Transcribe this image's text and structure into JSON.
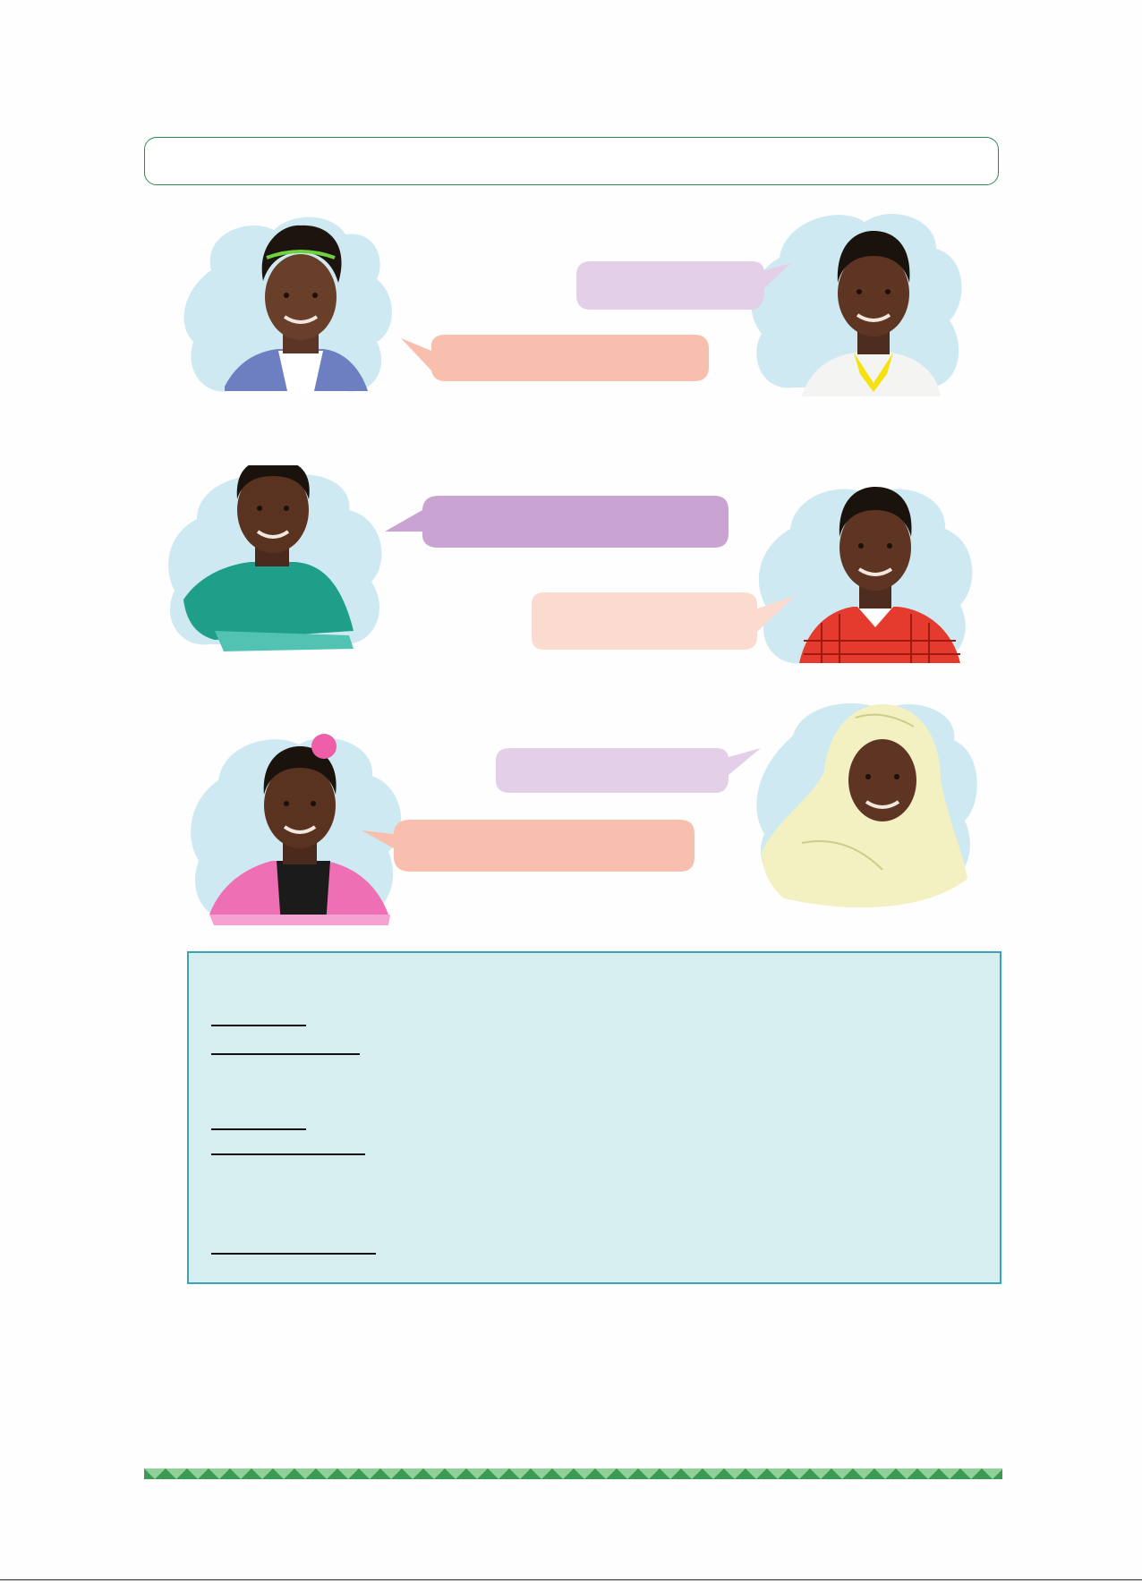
{
  "page": {
    "heading": "",
    "colors": {
      "heading_border": "#2e8b4e",
      "cloud_background": "#cfe9f2",
      "bubble_lavender": "#e3cfe8",
      "bubble_purple": "#c9a3d2",
      "bubble_salmon": "#f9bfae",
      "bubble_peach": "#fbdad0",
      "notes_box_fill": "#d7eef0",
      "notes_box_border": "#3ba3b7",
      "footer_band": "#3d9a52"
    }
  },
  "dialogues": [
    {
      "left_portrait": "girl-with-green-headband-portrait",
      "right_portrait": "boy-with-yellow-collar-portrait",
      "bubbles": [
        {
          "speaker": "right",
          "color": "lavender",
          "text": ""
        },
        {
          "speaker": "left",
          "color": "salmon",
          "text": ""
        }
      ]
    },
    {
      "left_portrait": "boy-in-teal-shirt-portrait",
      "right_portrait": "boy-in-red-checked-shirt-portrait",
      "bubbles": [
        {
          "speaker": "left",
          "color": "purple",
          "text": ""
        },
        {
          "speaker": "right",
          "color": "peach",
          "text": ""
        }
      ]
    },
    {
      "left_portrait": "girl-in-pink-jacket-portrait",
      "right_portrait": "girl-in-cream-headscarf-portrait",
      "bubbles": [
        {
          "speaker": "right",
          "color": "lavender",
          "text": ""
        },
        {
          "speaker": "left",
          "color": "salmon",
          "text": ""
        }
      ]
    }
  ],
  "notes_box": {
    "blank_lines": 5
  }
}
